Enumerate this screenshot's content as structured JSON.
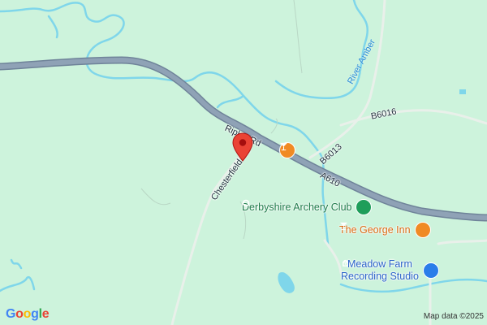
{
  "colors": {
    "land": "#cdf3dc",
    "major_road": "#8a9bb0",
    "minor_road": "#e9f0ea",
    "water": "#7fd6ea",
    "pin": "#ea4335",
    "bar_poi": "#f08a24",
    "park_poi": "#1e9e5a",
    "studio_poi": "#2b7de9"
  },
  "roads": {
    "ripley": "Ripley Rd",
    "chesterfield": "Chesterfield Rd",
    "b6016": "B6016",
    "b6013": "B6013",
    "a610": "A610"
  },
  "water": {
    "river": "River Amber"
  },
  "places": {
    "archery": {
      "label": "Derbyshire Archery Club",
      "icon": "park-icon"
    },
    "george": {
      "label": "The George Inn",
      "icon": "bar-icon"
    },
    "studio": {
      "label": "Meadow Farm Recording Studio",
      "line1": "Meadow Farm",
      "line2": "Recording Studio",
      "icon": "music-icon"
    },
    "bar_unlabeled": {
      "icon": "bar-icon"
    }
  },
  "marker": {
    "icon": "location-pin-icon"
  },
  "footer": {
    "logo": "Google",
    "attribution": "Map data ©2025"
  }
}
